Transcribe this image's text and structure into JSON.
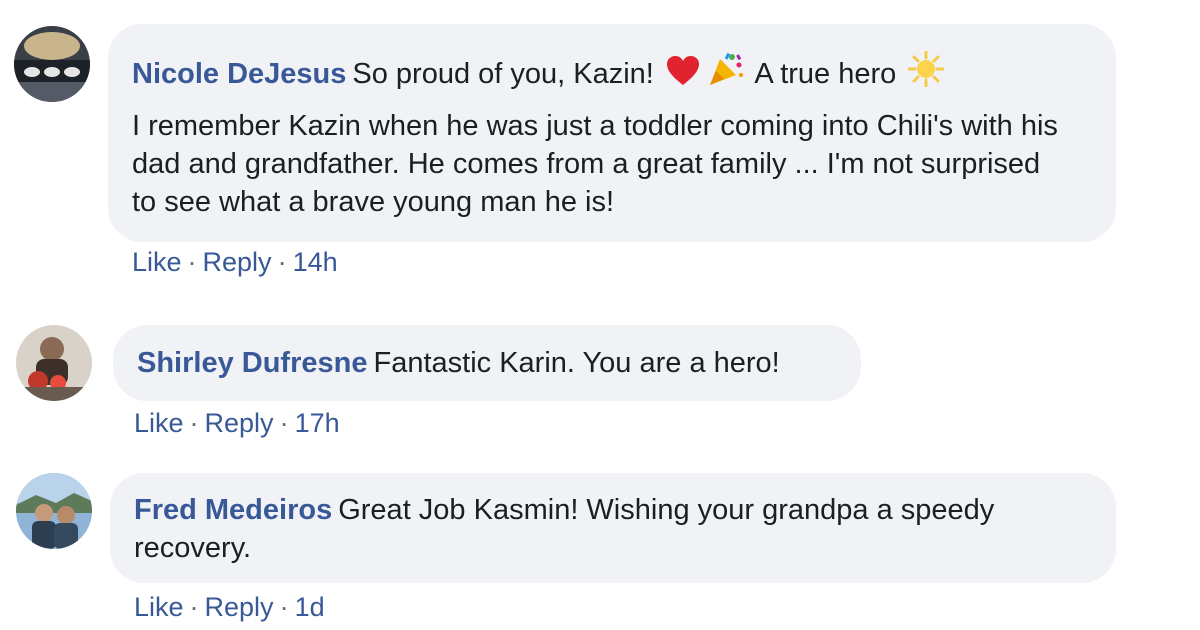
{
  "comments": [
    {
      "author": "Nicole DeJesus",
      "text_before_emoji": "So proud of you, Kazin!",
      "text_after_emoji": "A true hero",
      "emoji": [
        "heart-emoji",
        "party-popper-emoji",
        "sun-emoji"
      ],
      "body": "I remember Kazin when he was just a toddler coming into Chili's with his dad and grandfather. He comes from a great family ... I'm not surprised to see what a brave young man he is!",
      "like_label": "Like",
      "reply_label": "Reply",
      "time": "14h"
    },
    {
      "author": "Shirley Dufresne",
      "text": "Fantastic Karin. You are a hero!",
      "like_label": "Like",
      "reply_label": "Reply",
      "time": "17h"
    },
    {
      "author": "Fred Medeiros",
      "text": "Great Job Kasmin! Wishing your grandpa a speedy recovery.",
      "like_label": "Like",
      "reply_label": "Reply",
      "time": "1d"
    }
  ],
  "colors": {
    "author": "#385898",
    "bubble": "#f0f2f5",
    "text": "#1c1e21",
    "meta": "#606770"
  }
}
